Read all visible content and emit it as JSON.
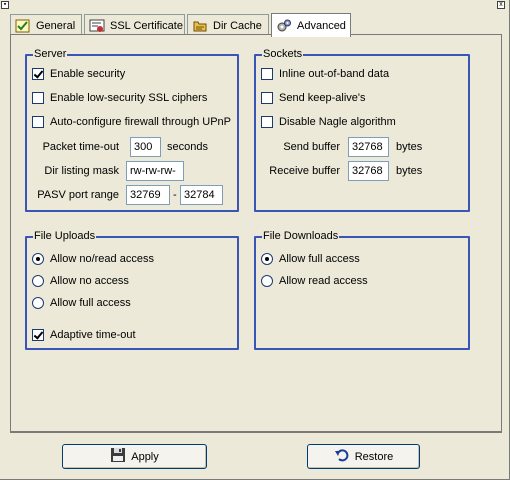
{
  "tabs": [
    {
      "label": "General",
      "icon": "check-document-icon",
      "active": false
    },
    {
      "label": "SSL Certificate",
      "icon": "certificate-icon",
      "active": false
    },
    {
      "label": "Dir Cache",
      "icon": "folder-cache-icon",
      "active": false
    },
    {
      "label": "Advanced",
      "icon": "gears-icon",
      "active": true
    }
  ],
  "server": {
    "title": "Server",
    "enable_security": {
      "label": "Enable security",
      "checked": true
    },
    "low_security_ssl": {
      "label": "Enable low-security SSL ciphers",
      "checked": false
    },
    "upnp": {
      "label": "Auto-configure firewall through UPnP",
      "checked": false
    },
    "packet_timeout": {
      "label": "Packet time-out",
      "value": "300",
      "unit": "seconds"
    },
    "dir_listing_mask": {
      "label": "Dir listing mask",
      "value": "rw-rw-rw-"
    },
    "pasv_range": {
      "label": "PASV port range",
      "from": "32769",
      "separator": "-",
      "to": "32784"
    }
  },
  "sockets": {
    "title": "Sockets",
    "inline_oob": {
      "label": "Inline out-of-band data",
      "checked": false
    },
    "keep_alive": {
      "label": "Send keep-alive's",
      "checked": false
    },
    "disable_nagle": {
      "label": "Disable Nagle algorithm",
      "checked": false
    },
    "send_buffer": {
      "label": "Send buffer",
      "value": "32768",
      "unit": "bytes"
    },
    "receive_buffer": {
      "label": "Receive buffer",
      "value": "32768",
      "unit": "bytes"
    }
  },
  "file_uploads": {
    "title": "File Uploads",
    "options": [
      {
        "label": "Allow no/read access",
        "selected": true
      },
      {
        "label": "Allow no access",
        "selected": false
      },
      {
        "label": "Allow full access",
        "selected": false
      }
    ],
    "adaptive_timeout": {
      "label": "Adaptive time-out",
      "checked": true
    }
  },
  "file_downloads": {
    "title": "File Downloads",
    "options": [
      {
        "label": "Allow full access",
        "selected": true
      },
      {
        "label": "Allow read access",
        "selected": false
      }
    ]
  },
  "buttons": {
    "apply": {
      "label": "Apply",
      "icon": "floppy-disk-icon"
    },
    "restore": {
      "label": "Restore",
      "icon": "undo-arrow-icon"
    }
  },
  "colors": {
    "group_border": "#3a55b8",
    "background": "#ece9d8"
  }
}
